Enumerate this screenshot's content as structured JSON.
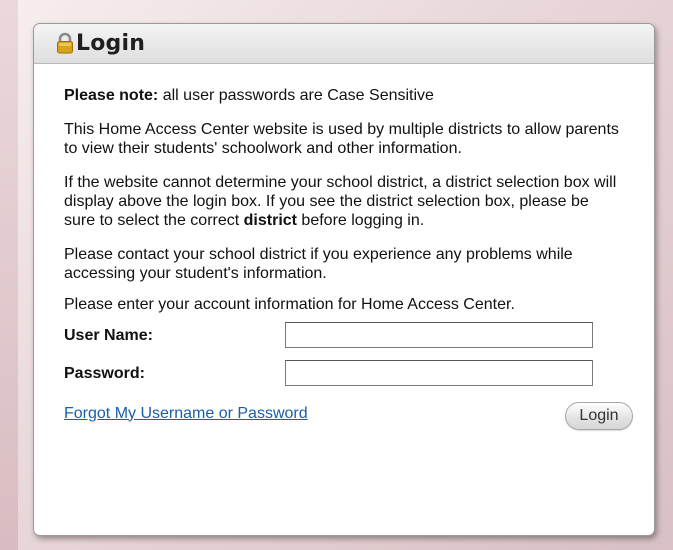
{
  "panel": {
    "title": "Login",
    "icon": "lock-icon"
  },
  "notes": {
    "note_label": "Please note:",
    "note_text": " all user passwords are Case Sensitive",
    "para1": "This Home Access Center website is used by multiple districts to allow parents to view their students' schoolwork and other information.",
    "para2_before": "If the website cannot determine your school district, a district selection box will display above the login box. If you see the district selection box, please be sure to select the correct ",
    "para2_bold": "district",
    "para2_after": " before logging in.",
    "para3": "Please contact your school district if you experience any problems while accessing your student's information.",
    "para4": "Please enter your account information for Home Access Center."
  },
  "form": {
    "username_label": "User Name:",
    "username_value": "",
    "password_label": "Password:",
    "password_value": ""
  },
  "actions": {
    "forgot_label": "Forgot My Username or Password",
    "login_label": "Login"
  },
  "colors": {
    "link": "#1a5fa8",
    "lock_body": "#d9a21b"
  }
}
